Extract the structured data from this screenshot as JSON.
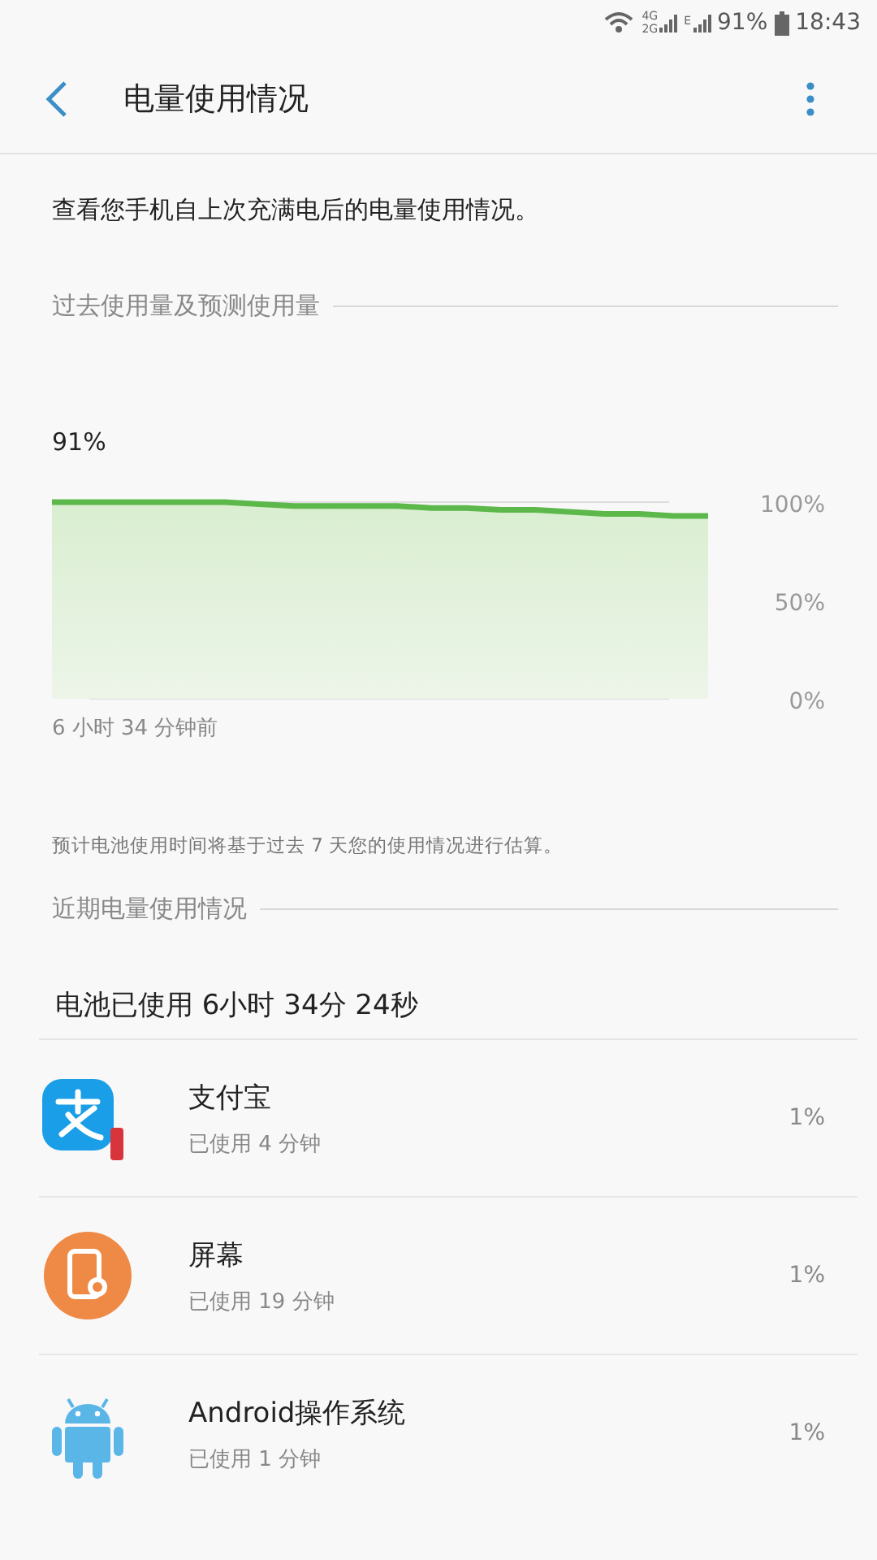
{
  "status_bar": {
    "network_labels": [
      "4G",
      "2G",
      "E"
    ],
    "battery": "91%",
    "time": "18:43"
  },
  "app_bar": {
    "title": "电量使用情况"
  },
  "description": "查看您手机自上次充满电后的电量使用情况。",
  "usage_graph": {
    "title": "过去使用量及预测使用量",
    "current": "91%",
    "axis_labels": [
      "100%",
      "50%",
      "0%"
    ],
    "start_label": "6 小时 34 分钟前",
    "note": "预计电池使用时间将基于过去 7 天您的使用情况进行估算。"
  },
  "recent": {
    "title": "近期电量使用情况",
    "summary": "电池已使用 6小时 34分 24秒",
    "apps": [
      {
        "kind": "alipay",
        "name": "支付宝",
        "usage": "已使用 4 分钟",
        "percent": "1%"
      },
      {
        "kind": "screen",
        "name": "屏幕",
        "usage": "已使用 19 分钟",
        "percent": "1%"
      },
      {
        "kind": "android",
        "name": "Android操作系统",
        "usage": "已使用 1 分钟",
        "percent": "1%"
      }
    ]
  }
}
